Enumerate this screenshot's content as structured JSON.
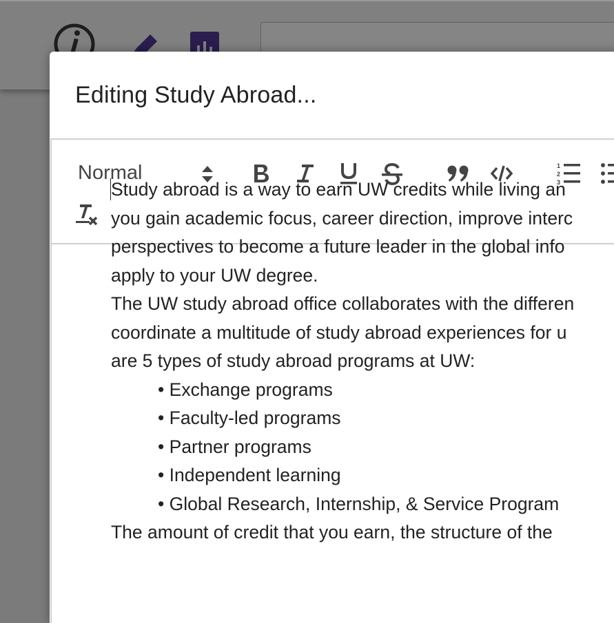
{
  "modal": {
    "title": "Editing Study Abroad..."
  },
  "toolbar": {
    "format_select_value": "Normal",
    "buttons": [
      "bold",
      "italic",
      "underline",
      "strikethrough",
      "blockquote",
      "code",
      "ordered-list",
      "bullet-list",
      "clear-formatting"
    ]
  },
  "content": {
    "paragraph1_lines": [
      "Study abroad is a way to earn UW credits while living an",
      "you gain academic focus, career direction, improve interc",
      "perspectives to become a future leader in the global info",
      "apply to your UW degree."
    ],
    "paragraph2_lines": [
      "The UW study abroad office collaborates with the differen",
      "coordinate a multitude of study abroad experiences for u",
      "are 5 types of study abroad programs at UW:"
    ],
    "program_types": [
      "Exchange programs",
      "Faculty-led programs",
      "Partner programs",
      "Independent learning",
      "Global Research, Internship, & Service Program"
    ],
    "partial_last_line": "The amount of credit that you earn, the structure of the"
  },
  "colors": {
    "brand_purple": "#4b2e83",
    "overlay_gray": "#7b7b7b",
    "text": "#222222",
    "toolbar_icon": "#444444"
  }
}
